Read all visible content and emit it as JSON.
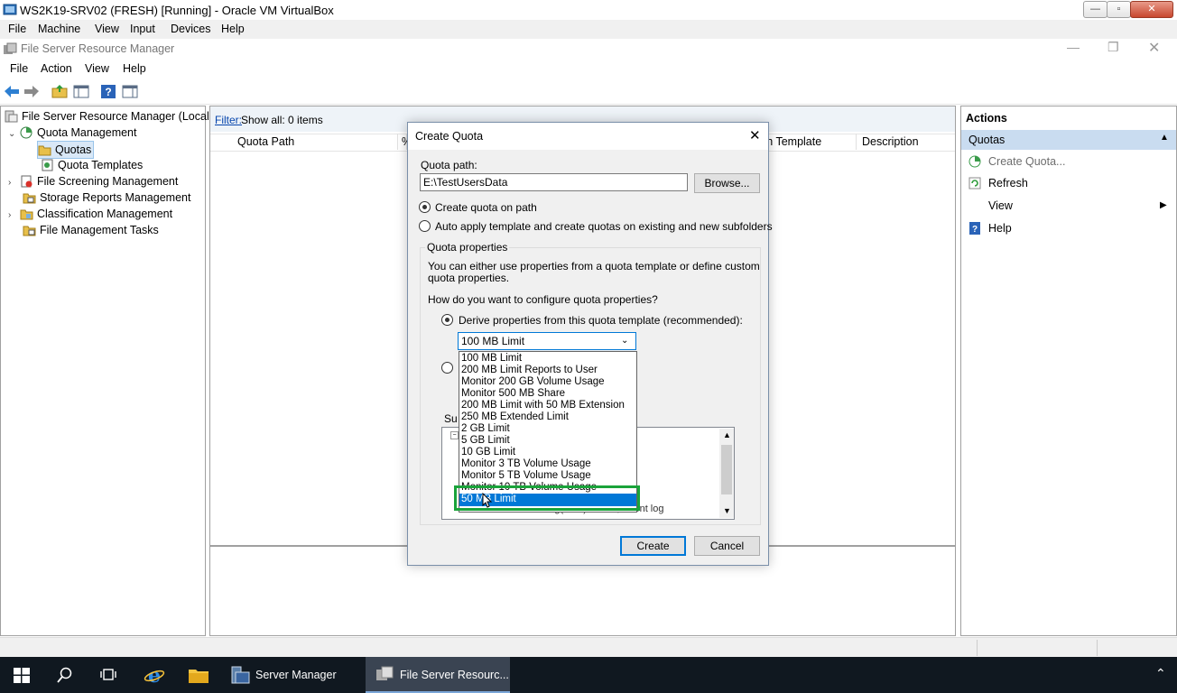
{
  "vbox": {
    "title": "WS2K19-SRV02 (FRESH) [Running] - Oracle VM VirtualBox",
    "menu": [
      "File",
      "Machine",
      "View",
      "Input",
      "Devices",
      "Help"
    ]
  },
  "fsrm": {
    "title": "File Server Resource Manager",
    "menu": [
      "File",
      "Action",
      "View",
      "Help"
    ]
  },
  "tree": {
    "root": "File Server Resource Manager (Local)",
    "quota_management": "Quota Management",
    "quotas": "Quotas",
    "quota_templates": "Quota Templates",
    "file_screening": "File Screening Management",
    "storage_reports": "Storage Reports Management",
    "classification": "Classification Management",
    "file_management_tasks": "File Management Tasks"
  },
  "center": {
    "filter_label": "Filter:",
    "filter_text": "Show all: 0 items",
    "columns": [
      "Quota Path",
      "%",
      "ch Template",
      "Description"
    ]
  },
  "actions": {
    "title": "Actions",
    "section": "Quotas",
    "items": [
      "Create Quota...",
      "Refresh",
      "View",
      "Help"
    ]
  },
  "dialog": {
    "title": "Create Quota",
    "quota_path_label": "Quota path:",
    "quota_path_value": "E:\\TestUsersData",
    "browse": "Browse...",
    "radio_create": "Create quota on path",
    "radio_auto": "Auto apply template and create quotas on existing and new subfolders",
    "props_group": "Quota properties",
    "props_desc_1": "You can either use properties from a quota template or define custom",
    "props_desc_2": "quota properties.",
    "how_question": "How do you want to configure quota properties?",
    "radio_derive": "Derive properties from this quota template (recommended):",
    "template_selected": "100 MB Limit",
    "summary_label_partial": "Su",
    "summary_peek": "Warning(85%): Email, Event log",
    "create": "Create",
    "cancel": "Cancel"
  },
  "dropdown_options": [
    "100 MB Limit",
    "200 MB Limit Reports to User",
    "Monitor 200 GB Volume Usage",
    "Monitor 500 MB Share",
    "200 MB Limit with 50 MB Extension",
    "250 MB Extended Limit",
    "2 GB Limit",
    "5 GB Limit",
    "10 GB Limit",
    "Monitor 3 TB Volume Usage",
    "Monitor 5 TB Volume Usage",
    "Monitor 10 TB Volume Usage",
    "50 MB Limit"
  ],
  "dropdown_highlighted": "50 MB Limit",
  "highlight_color": "#1aa33a",
  "taskbar": {
    "apps": [
      "Server Manager",
      "File Server Resourc..."
    ]
  }
}
